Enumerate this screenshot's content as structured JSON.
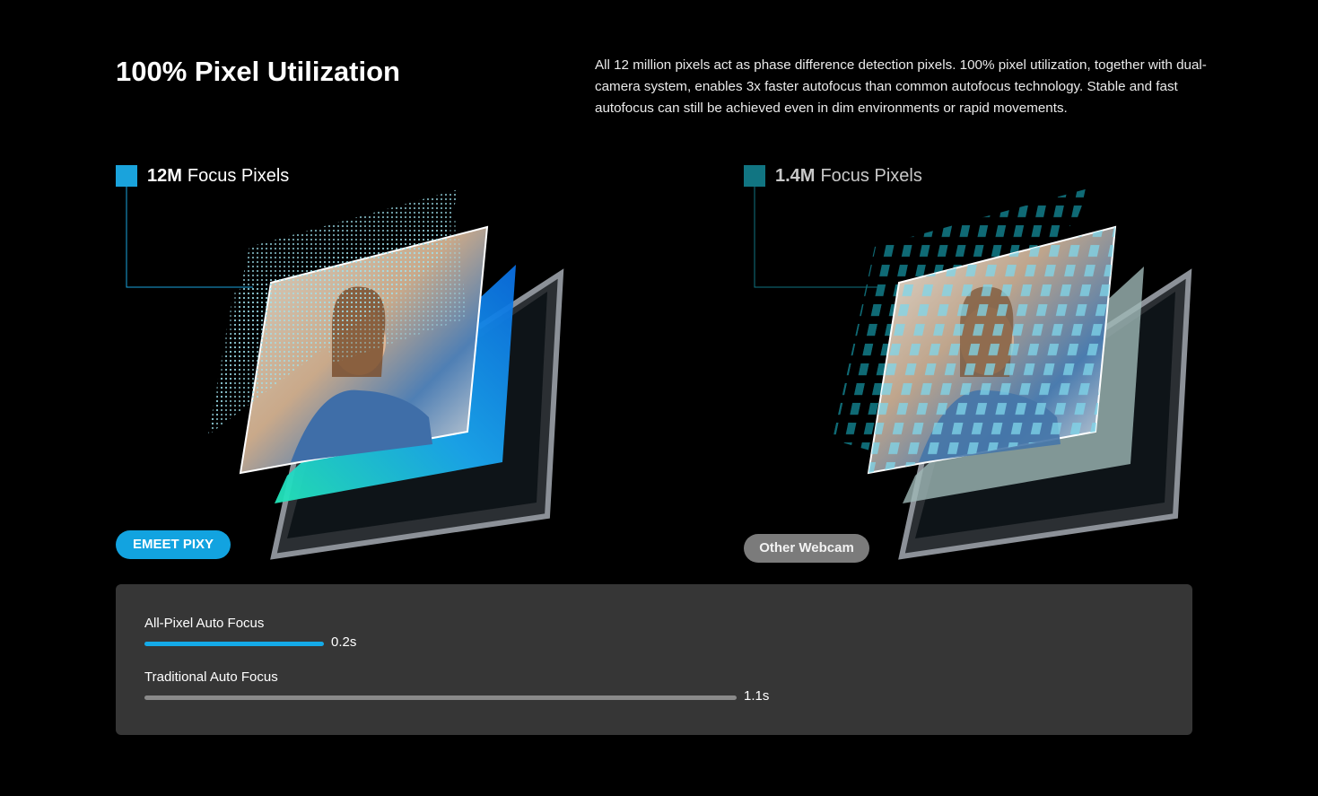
{
  "headline": "100% Pixel Utilization",
  "intro": "All 12 million pixels act as phase difference detection pixels. 100% pixel utilization, together with dual-camera system, enables 3x faster autofocus than common autofocus technology. Stable and fast autofocus can still be achieved even in dim environments or rapid movements.",
  "left_panel": {
    "legend_bold": "12M",
    "legend_rest": "Focus Pixels",
    "product_tag": "EMEET PIXY",
    "accent_color": "#1aa3dc"
  },
  "right_panel": {
    "legend_bold": "1.4M",
    "legend_rest": "Focus Pixels",
    "product_tag": "Other Webcam",
    "accent_color": "#117582"
  },
  "comparison": {
    "rows": [
      {
        "label": "All-Pixel Auto Focus",
        "value": "0.2s",
        "seconds": 0.2,
        "color": "#14aae8"
      },
      {
        "label": "Traditional Auto Focus",
        "value": "1.1s",
        "seconds": 1.1,
        "color": "#8a8a8a"
      }
    ]
  }
}
